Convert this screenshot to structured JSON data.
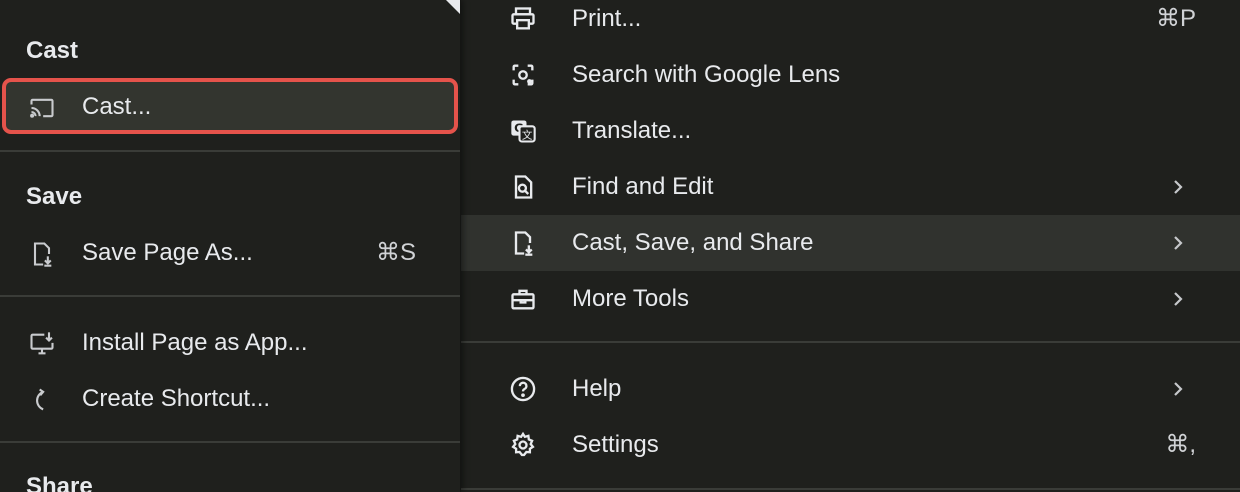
{
  "submenu": {
    "cast_section": {
      "title": "Cast",
      "items": [
        {
          "label": "Cast...",
          "icon": "cast-icon"
        }
      ]
    },
    "save_section": {
      "title": "Save",
      "items": [
        {
          "label": "Save Page As...",
          "shortcut": "⌘S",
          "icon": "save-page-icon"
        }
      ]
    },
    "app_section": {
      "items": [
        {
          "label": "Install Page as App...",
          "icon": "install-app-icon"
        },
        {
          "label": "Create Shortcut...",
          "icon": "shortcut-icon"
        }
      ]
    },
    "share_section": {
      "title": "Share"
    }
  },
  "mainmenu": {
    "items": [
      {
        "label": "Print...",
        "shortcut": "⌘P",
        "icon": "print-icon"
      },
      {
        "label": "Search with Google Lens",
        "icon": "google-lens-icon"
      },
      {
        "label": "Translate...",
        "icon": "translate-icon"
      },
      {
        "label": "Find and Edit",
        "icon": "find-edit-icon",
        "submenu": true
      },
      {
        "label": "Cast, Save, and Share",
        "icon": "cast-save-share-icon",
        "submenu": true,
        "active": true
      },
      {
        "label": "More Tools",
        "icon": "toolbox-icon",
        "submenu": true
      },
      {
        "label": "Help",
        "icon": "help-icon",
        "submenu": true
      },
      {
        "label": "Settings",
        "shortcut": "⌘,",
        "icon": "gear-icon"
      }
    ]
  },
  "colors": {
    "background": "#1f201d",
    "highlight_border": "#e5534b",
    "active_row": "#30322e",
    "text": "#e8eaed",
    "divider": "#3a3c38"
  }
}
